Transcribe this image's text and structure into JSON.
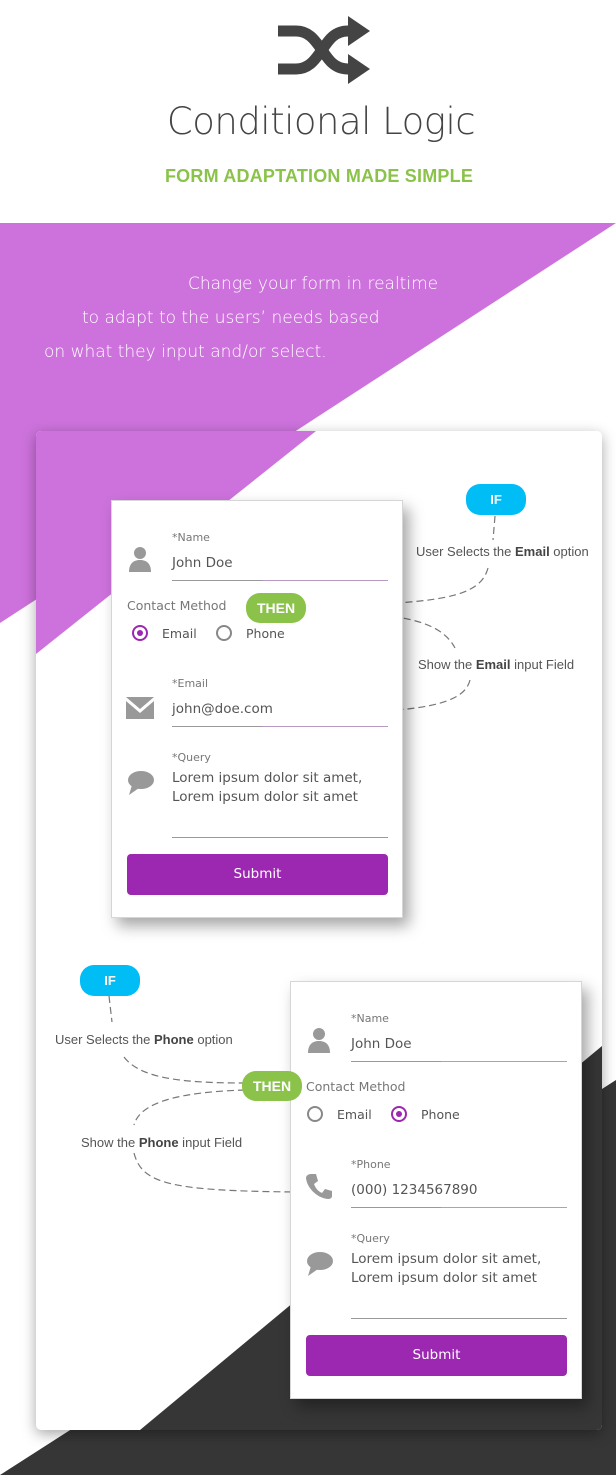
{
  "header": {
    "logo_icon": "shuffle-icon",
    "title": "Conditional Logic",
    "subtitle": "FORM ADAPTATION MADE SIMPLE"
  },
  "intro": {
    "line1": "Change your form in realtime",
    "line2": "to adapt to the users’ needs based",
    "line3": "on what they input and/or select."
  },
  "colors": {
    "purple_bg": "#cd72dc",
    "accent_purple": "#9c27b0",
    "green": "#8bc34a",
    "blue": "#00bdf5",
    "dark_bg": "#363636",
    "text": "#444444"
  },
  "example_email": {
    "if_badge": "IF",
    "then_badge": "THEN",
    "condition": {
      "prefix": "User Selects the ",
      "bold": "Email",
      "suffix": " option"
    },
    "action": {
      "prefix": "Show the ",
      "bold": "Email",
      "suffix": " input Field"
    },
    "form": {
      "name_label": "*Name",
      "name_value": "John Doe",
      "contact_label": "Contact Method",
      "options": [
        "Email",
        "Phone"
      ],
      "selected": "Email",
      "field_label": "*Email",
      "field_value": "john@doe.com",
      "query_label": "*Query",
      "query_line1": "Lorem ipsum dolor sit amet,",
      "query_line2": "Lorem ipsum dolor sit amet",
      "submit": "Submit"
    }
  },
  "example_phone": {
    "if_badge": "IF",
    "then_badge": "THEN",
    "condition": {
      "prefix": "User Selects the ",
      "bold": "Phone",
      "suffix": " option"
    },
    "action": {
      "prefix": "Show the ",
      "bold": "Phone",
      "suffix": " input Field"
    },
    "form": {
      "name_label": "*Name",
      "name_value": "John Doe",
      "contact_label": "Contact Method",
      "options": [
        "Email",
        "Phone"
      ],
      "selected": "Phone",
      "field_label": "*Phone",
      "field_value": "(000) 1234567890",
      "query_label": "*Query",
      "query_line1": "Lorem ipsum dolor sit amet,",
      "query_line2": "Lorem ipsum dolor sit amet",
      "submit": "Submit"
    }
  }
}
